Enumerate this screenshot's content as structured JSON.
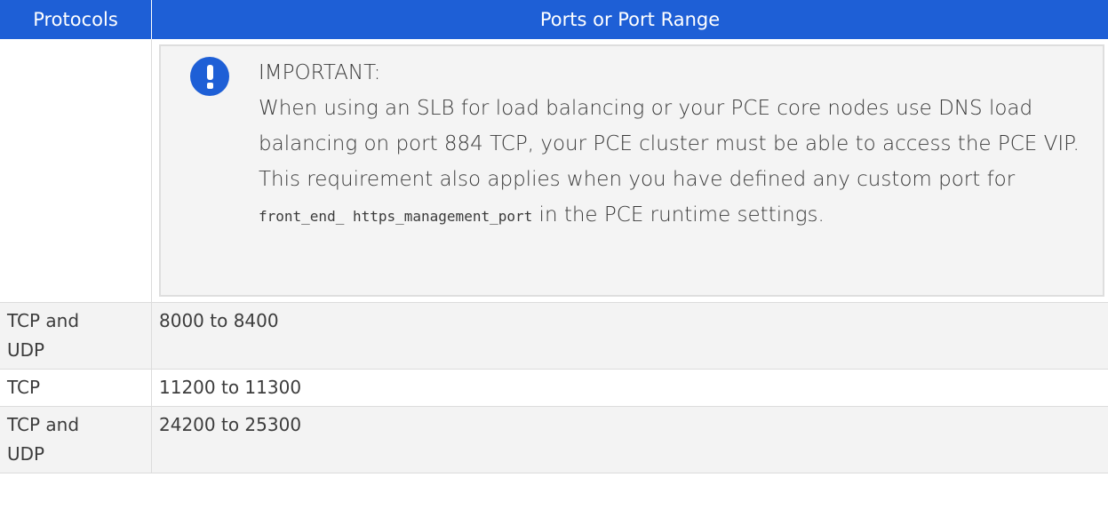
{
  "table": {
    "headers": {
      "protocols": "Protocols",
      "ports": "Ports or Port Range"
    },
    "note": {
      "icon": "exclamation-icon",
      "title": "IMPORTANT:",
      "text_before_code1": "When using an SLB for load balancing or your PCE core nodes use DNS load balancing on port 884 TCP, your PCE cluster must be able to access the PCE VIP. This requirement also applies when you have defined any custom port for ",
      "code": "front_end_ https_management_port",
      "text_after_code": " in the PCE runtime settings."
    },
    "rows": [
      {
        "protocol": "TCP and\nUDP",
        "ports": "8000 to 8400"
      },
      {
        "protocol": "TCP",
        "ports": "11200 to 11300"
      },
      {
        "protocol": "TCP and\nUDP",
        "ports": "24200 to 25300"
      }
    ]
  },
  "colors": {
    "header_bg": "#1e5fd6",
    "icon_bg": "#1e5fd6",
    "alt_row_bg": "#f3f3f3"
  }
}
